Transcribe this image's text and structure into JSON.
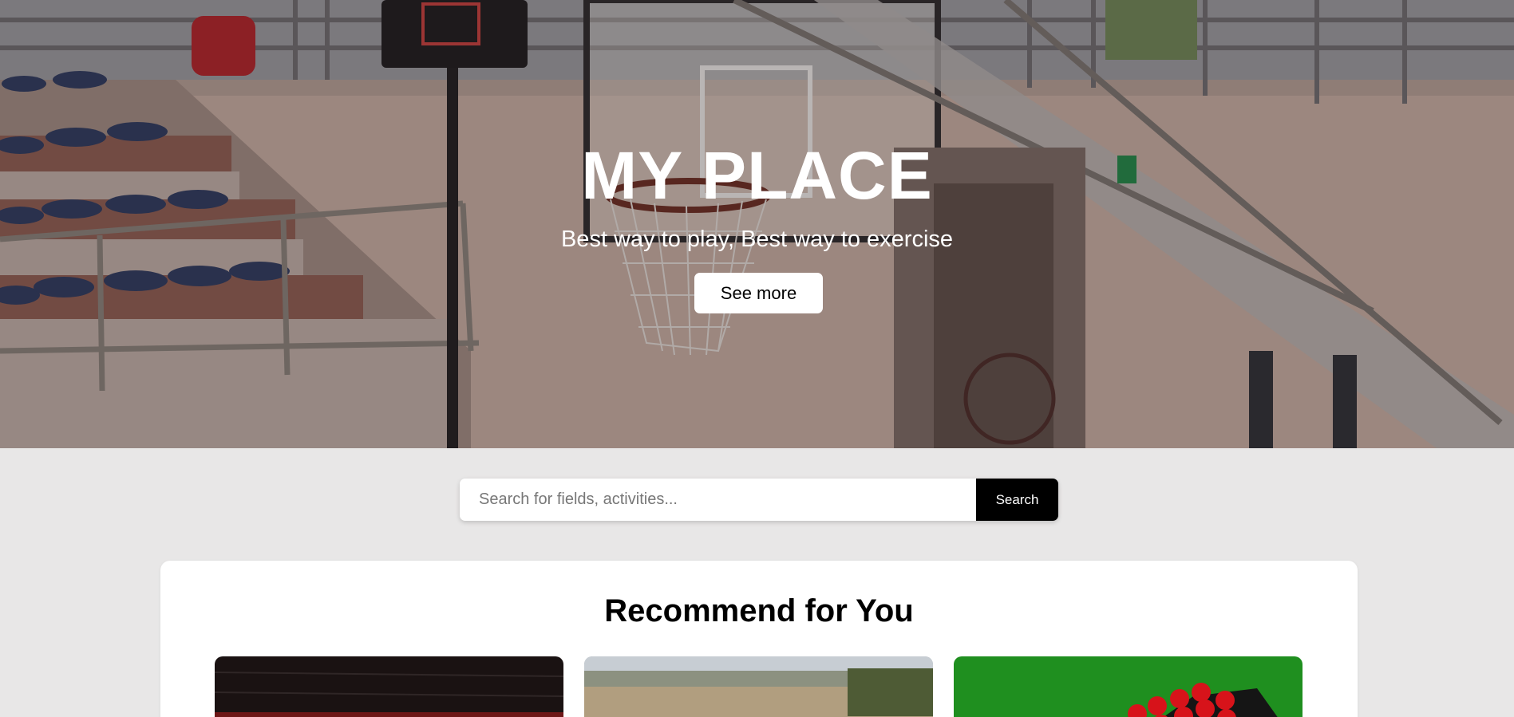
{
  "hero": {
    "title": "MY PLACE",
    "subtitle": "Best way to play, Best way to exercise",
    "cta_label": "See more"
  },
  "search": {
    "placeholder": "Search for fields, activities...",
    "value": "",
    "button_label": "Search"
  },
  "recommend": {
    "title": "Recommend for You",
    "cards": [
      {
        "subject": "indoor-court-dark"
      },
      {
        "subject": "outdoor-field-dome"
      },
      {
        "subject": "snooker-table"
      }
    ]
  },
  "colors": {
    "page_bg": "#e8e7e7",
    "button_dark": "#000000",
    "button_light": "#ffffff",
    "card_green": "#1f8f1f"
  }
}
